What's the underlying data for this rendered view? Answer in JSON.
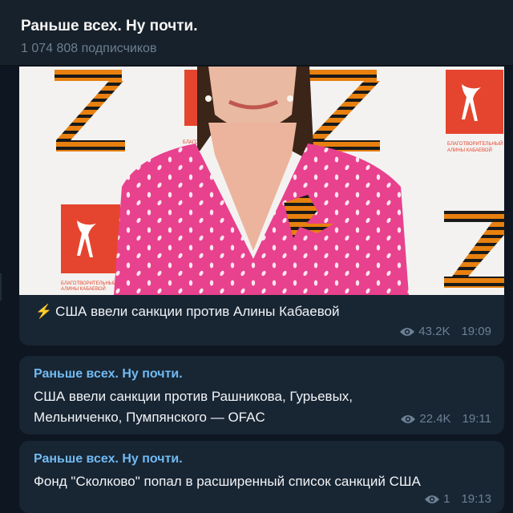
{
  "channel": {
    "title": "Раньше всех. Ну почти.",
    "subscribers": "1 074 808 подписчиков"
  },
  "messages": [
    {
      "icon": "lightning-icon",
      "emoji": "⚡",
      "text": "США ввели санкции против Алины Кабаевой",
      "views": "43.2K",
      "time": "19:09",
      "photo": {
        "backdrop_caption_1": "БЛАГОТВОРИТЕЛЬНЫЙ ФОНД АЛИНЫ КАБАЕВОЙ",
        "backdrop_caption_2": "БЛАГОТВОРИТЕЛЬНЫЙ ФОНД АЛИНЫ КАБАЕВОЙ",
        "backdrop_caption_3": "БЛАГОТВОРИТЕЛЬНЫЙ ФОНД"
      }
    },
    {
      "sender": "Раньше всех. Ну почти.",
      "text_line1": "США ввели санкции против Рашникова, Гурьевых,",
      "text_line2": "Мельниченко, Пумпянского — OFAC",
      "views": "22.4K",
      "time": "19:11"
    },
    {
      "sender": "Раньше всех. Ну почти.",
      "text": "Фонд \"Сколково\" попал в расширенный список санкций США",
      "views": "1",
      "time": "19:13"
    }
  ],
  "colors": {
    "background": "#0e1621",
    "bubble": "#182533",
    "sender": "#71baf2",
    "meta": "#6d8094"
  }
}
